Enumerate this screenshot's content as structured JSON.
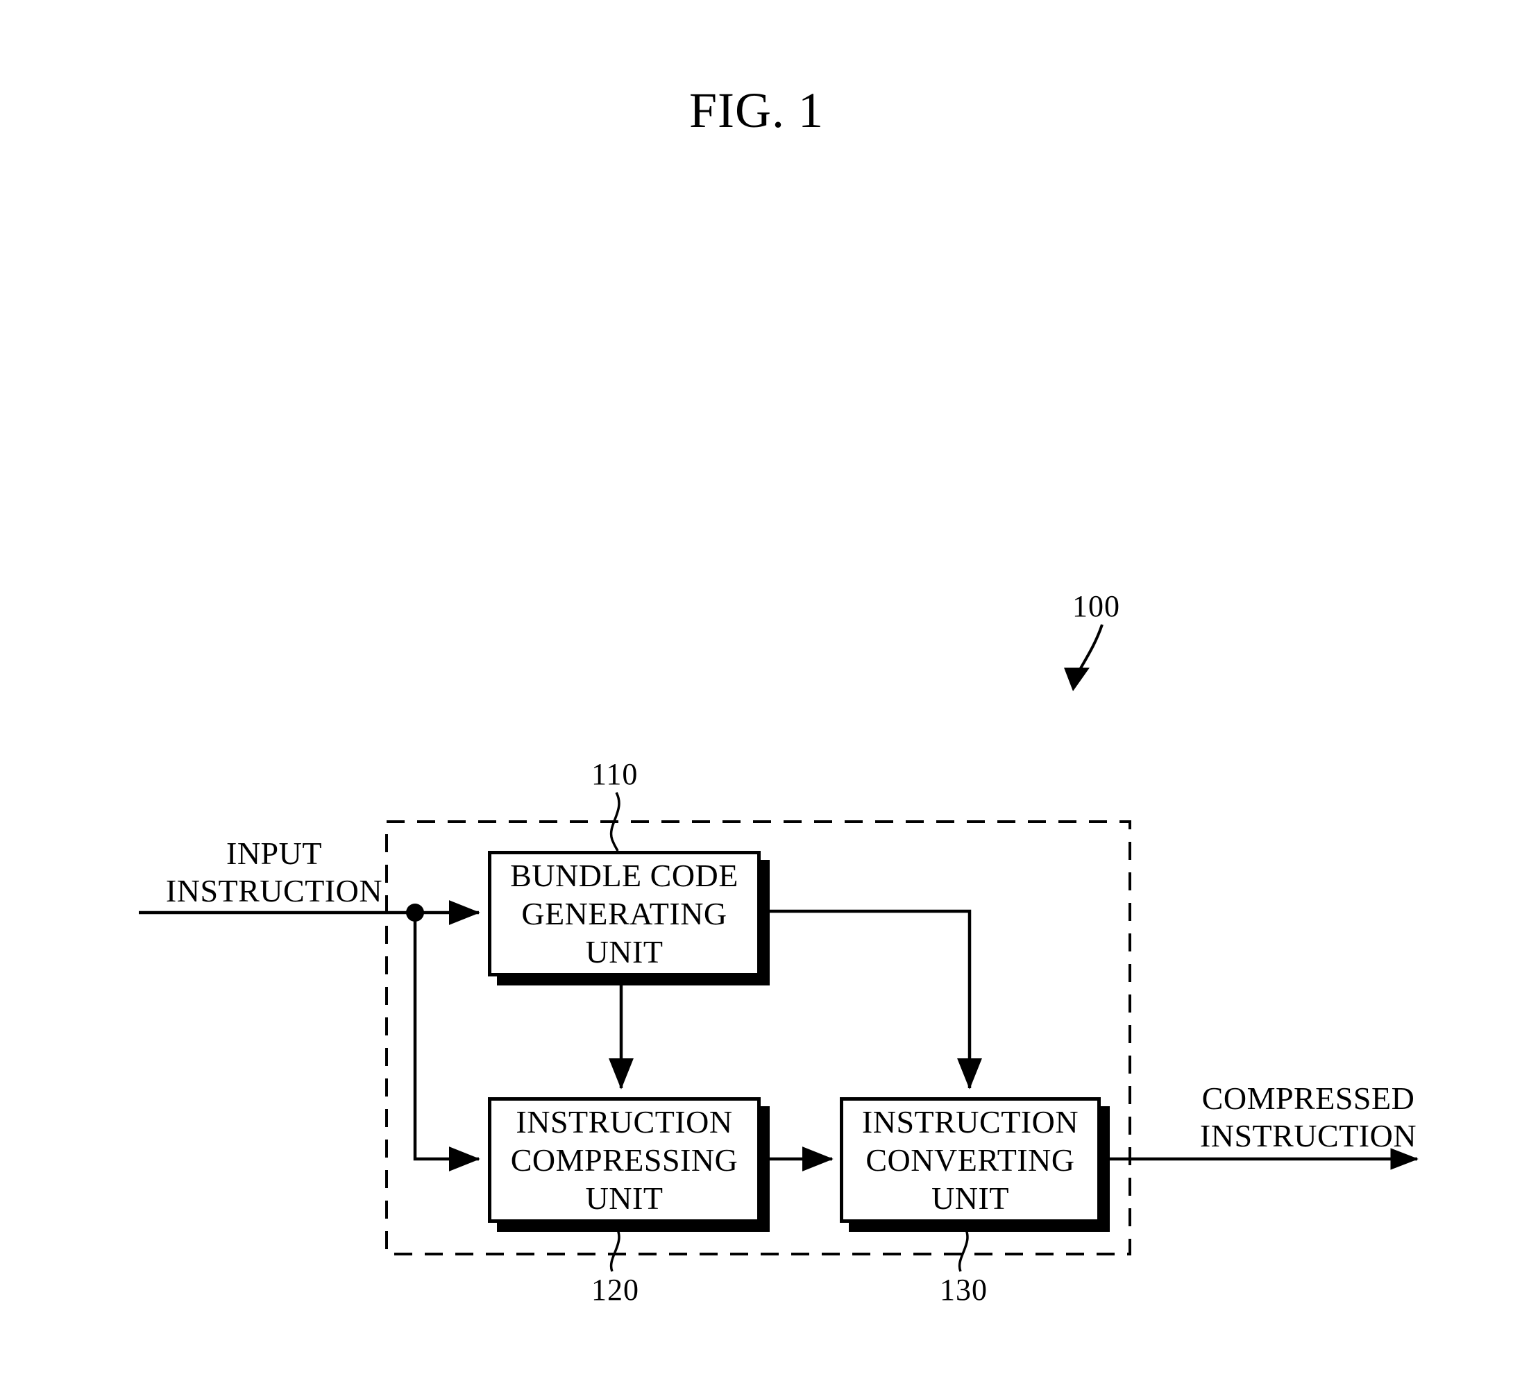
{
  "figure": {
    "title": "FIG. 1",
    "system_ref": "100"
  },
  "signals": {
    "input": "INPUT\nINSTRUCTION",
    "output": "COMPRESSED\nINSTRUCTION"
  },
  "blocks": [
    {
      "id": "bundle-code-generating-unit",
      "label": "BUNDLE CODE\nGENERATING\nUNIT",
      "ref": "110"
    },
    {
      "id": "instruction-compressing-unit",
      "label": "INSTRUCTION\nCOMPRESSING\nUNIT",
      "ref": "120"
    },
    {
      "id": "instruction-converting-unit",
      "label": "INSTRUCTION\nCONVERTING\nUNIT",
      "ref": "130"
    }
  ],
  "colors": {
    "ink": "#000000",
    "paper": "#ffffff"
  }
}
